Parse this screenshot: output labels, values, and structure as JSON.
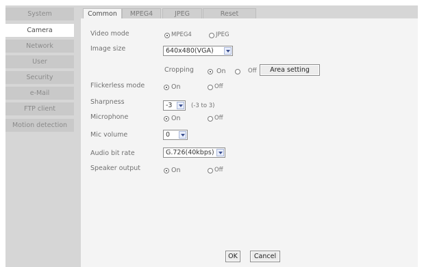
{
  "sidebar": {
    "items": [
      {
        "label": "System",
        "active": false
      },
      {
        "label": "Camera",
        "active": true
      },
      {
        "label": "Network",
        "active": false
      },
      {
        "label": "User",
        "active": false
      },
      {
        "label": "Security",
        "active": false
      },
      {
        "label": "e-Mail",
        "active": false
      },
      {
        "label": "FTP client",
        "active": false
      },
      {
        "label": "Motion detection",
        "active": false
      }
    ]
  },
  "tabs": [
    {
      "label": "Common",
      "active": true
    },
    {
      "label": "MPEG4",
      "active": false
    },
    {
      "label": "JPEG",
      "active": false
    },
    {
      "label": "Reset",
      "active": false
    }
  ],
  "form": {
    "video_mode": {
      "label": "Video mode",
      "options": [
        "MPEG4",
        "JPEG"
      ],
      "selected": "MPEG4"
    },
    "image_size": {
      "label": "Image size",
      "value": "640x480(VGA)"
    },
    "cropping": {
      "label": "Cropping",
      "on": "On",
      "off": "Off",
      "selected": "On",
      "button": "Area setting"
    },
    "flickerless": {
      "label": "Flickerless mode",
      "on": "On",
      "off": "Off",
      "selected": "On"
    },
    "sharpness": {
      "label": "Sharpness",
      "value": "-3",
      "range": "(-3 to 3)"
    },
    "microphone": {
      "label": "Microphone",
      "on": "On",
      "off": "Off",
      "selected": "On"
    },
    "mic_volume": {
      "label": "Mic volume",
      "value": "0"
    },
    "audio_bit_rate": {
      "label": "Audio bit rate",
      "value": "G.726(40kbps)"
    },
    "speaker_output": {
      "label": "Speaker output",
      "on": "On",
      "off": "Off",
      "selected": "On"
    }
  },
  "buttons": {
    "ok": "OK",
    "cancel": "Cancel"
  }
}
